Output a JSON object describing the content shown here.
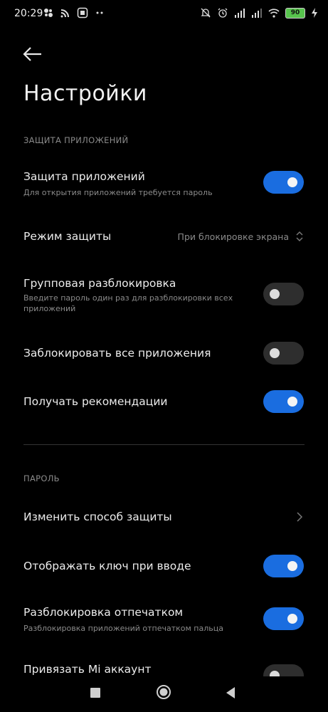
{
  "status": {
    "time": "20:29",
    "battery": "90"
  },
  "page": {
    "title": "Настройки"
  },
  "sections": {
    "protection_header": "ЗАЩИТА ПРИЛОЖЕНИЙ",
    "password_header": "ПАРОЛЬ"
  },
  "rows": {
    "app_protection": {
      "title": "Защита приложений",
      "subtitle": "Для открытия приложений требуется пароль",
      "enabled": true
    },
    "protection_mode": {
      "title": "Режим защиты",
      "value": "При блокировке экрана"
    },
    "group_unlock": {
      "title": "Групповая разблокировка",
      "subtitle": "Введите пароль один раз для разблокировки всех приложений",
      "enabled": false
    },
    "lock_all": {
      "title": "Заблокировать все приложения",
      "enabled": false
    },
    "recommendations": {
      "title": "Получать рекомендации",
      "enabled": true
    },
    "change_method": {
      "title": "Изменить способ защиты"
    },
    "show_key": {
      "title": "Отображать ключ при вводе",
      "enabled": true
    },
    "fingerprint": {
      "title": "Разблокировка отпечатком",
      "subtitle": "Разблокировка приложений отпечатком пальца",
      "enabled": true
    },
    "mi_account": {
      "title": "Привязать Mi аккаунт",
      "enabled": false
    }
  },
  "colors": {
    "accent": "#1a6de0",
    "background": "#000000",
    "toggle_off": "#2e2e2e"
  },
  "icons": [
    "bell-off-icon",
    "alarm-icon",
    "signal-icon",
    "wifi-icon",
    "battery-icon",
    "charging-icon",
    "back-arrow-icon",
    "chevron-right-icon",
    "expand-icon"
  ]
}
